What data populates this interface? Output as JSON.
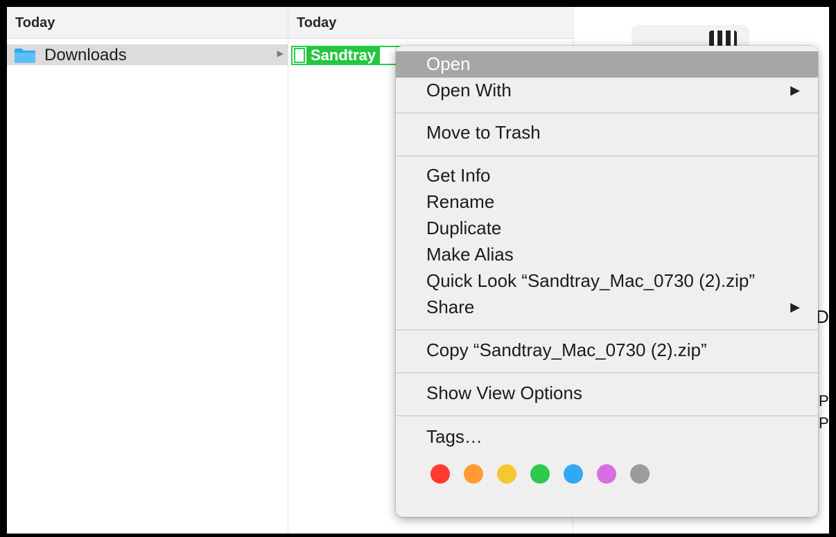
{
  "columns": [
    {
      "header": "Today"
    },
    {
      "header": "Today"
    }
  ],
  "sidebar": {
    "selected_item": {
      "label": "Downloads",
      "icon": "folder-icon",
      "color": "#2fa8f0"
    }
  },
  "file_rename": {
    "value": "Sandtray",
    "icon": "file-icon",
    "highlight_color": "#27c53f"
  },
  "preview": {
    "clipped_texts": [
      "D",
      "PM",
      "PM"
    ]
  },
  "context_menu": {
    "items": [
      {
        "label": "Open",
        "highlighted": true
      },
      {
        "label": "Open With",
        "submenu": true
      },
      {
        "label": "Move to Trash"
      },
      {
        "label": "Get Info"
      },
      {
        "label": "Rename"
      },
      {
        "label": "Duplicate"
      },
      {
        "label": "Make Alias"
      },
      {
        "label": "Quick Look “Sandtray_Mac_0730 (2).zip”"
      },
      {
        "label": "Share",
        "submenu": true
      },
      {
        "label": "Copy “Sandtray_Mac_0730 (2).zip”"
      },
      {
        "label": "Show View Options"
      },
      {
        "label": "Tags…"
      }
    ],
    "submenu_arrow": "▶",
    "tags": [
      {
        "name": "Red",
        "color": "#ff3b30"
      },
      {
        "name": "Orange",
        "color": "#ff9a35"
      },
      {
        "name": "Yellow",
        "color": "#f7c82d"
      },
      {
        "name": "Green",
        "color": "#2ec84a"
      },
      {
        "name": "Blue",
        "color": "#31a8f5"
      },
      {
        "name": "Purple",
        "color": "#d86ee0"
      },
      {
        "name": "Gray",
        "color": "#9b9b9b"
      }
    ]
  },
  "colors": {
    "menu_bg": "#efefef",
    "menu_highlight": "#a6a6a6",
    "selection_gray": "#dcdcdc",
    "finder_blue": "#2fa8f0"
  }
}
